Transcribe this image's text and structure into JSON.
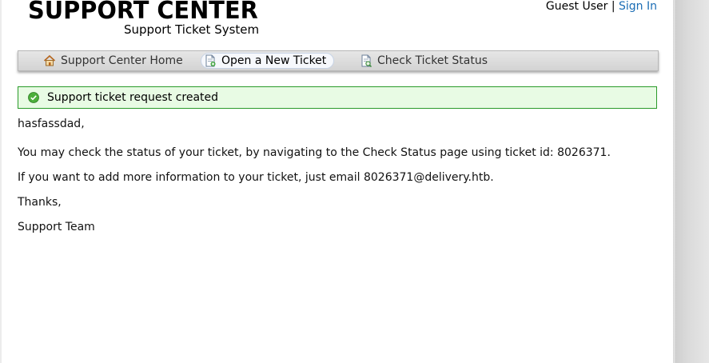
{
  "header": {
    "logo_title": "SUPPORT CENTER",
    "logo_subtitle": "Support Ticket System",
    "user_label": "Guest User",
    "separator": "|",
    "sign_in": "Sign In"
  },
  "nav": {
    "items": [
      {
        "label": "Support Center Home",
        "icon": "home-icon",
        "active": false
      },
      {
        "label": "Open a New Ticket",
        "icon": "new-ticket-icon",
        "active": true
      },
      {
        "label": "Check Ticket Status",
        "icon": "ticket-status-icon",
        "active": false
      }
    ]
  },
  "alert": {
    "icon": "success-check-icon",
    "message": "Support ticket request created"
  },
  "message": {
    "greeting": "hasfassdad,",
    "line1": "You may check the status of your ticket, by navigating to the Check Status page using ticket id: 8026371.",
    "line2": "If you want to add more information to your ticket, just email 8026371@delivery.htb.",
    "thanks": "Thanks,",
    "signature": "Support Team"
  },
  "colors": {
    "link": "#1b6db5",
    "alert_bg": "#e8fbe4",
    "alert_border": "#2a9b2a"
  }
}
